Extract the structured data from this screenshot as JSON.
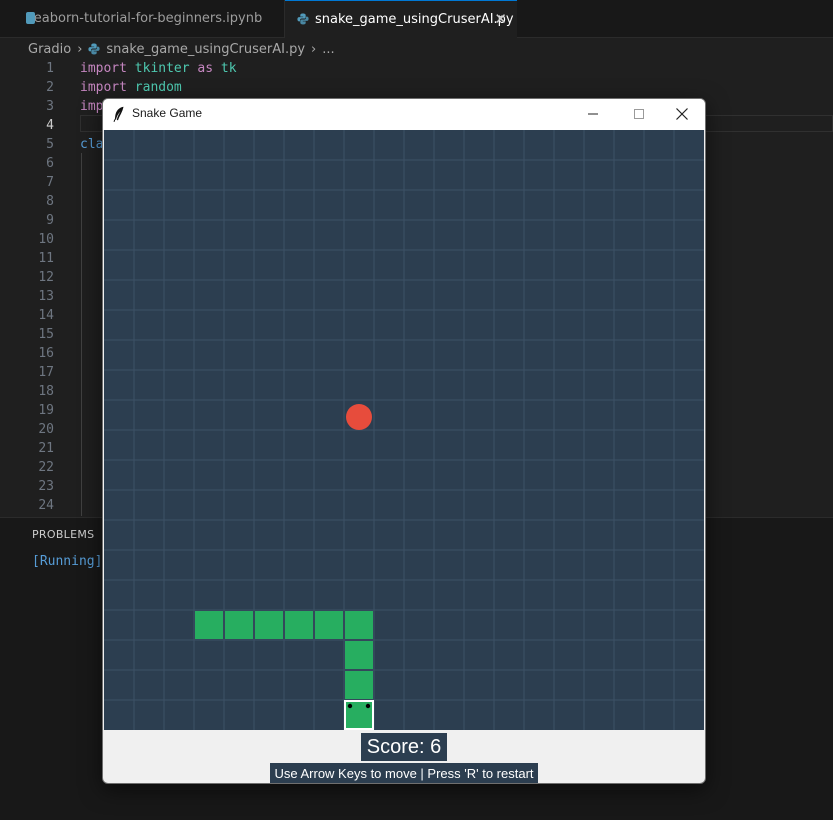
{
  "tabs": [
    {
      "label": "seaborn-tutorial-for-beginners.ipynb",
      "active": false,
      "icon": "notebook-icon"
    },
    {
      "label": "snake_game_usingCruserAI.py",
      "active": true,
      "icon": "python-icon"
    }
  ],
  "breadcrumb": {
    "folder": "Gradio",
    "file": "snake_game_usingCruserAI.py",
    "more": "..."
  },
  "editor": {
    "current_line": 4,
    "lines": [
      {
        "n": "1",
        "tokens": [
          [
            "kw",
            "import"
          ],
          [
            "",
            " "
          ],
          [
            "mod",
            "tkinter"
          ],
          [
            "",
            " "
          ],
          [
            "kw",
            "as"
          ],
          [
            "",
            " "
          ],
          [
            "mod",
            "tk"
          ]
        ]
      },
      {
        "n": "2",
        "tokens": [
          [
            "kw",
            "import"
          ],
          [
            "",
            " "
          ],
          [
            "mod",
            "random"
          ]
        ]
      },
      {
        "n": "3",
        "tokens": [
          [
            "kw",
            "imp"
          ]
        ]
      },
      {
        "n": "4",
        "tokens": []
      },
      {
        "n": "5",
        "tokens": [
          [
            "kwb",
            "cla"
          ]
        ]
      },
      {
        "n": "6",
        "tokens": []
      },
      {
        "n": "7",
        "tokens": []
      },
      {
        "n": "8",
        "tokens": []
      },
      {
        "n": "9",
        "tokens": []
      },
      {
        "n": "10",
        "tokens": []
      },
      {
        "n": "11",
        "tokens": []
      },
      {
        "n": "12",
        "tokens": []
      },
      {
        "n": "13",
        "tokens": []
      },
      {
        "n": "14",
        "tokens": []
      },
      {
        "n": "15",
        "tokens": []
      },
      {
        "n": "16",
        "tokens": []
      },
      {
        "n": "17",
        "tokens": []
      },
      {
        "n": "18",
        "tokens": []
      },
      {
        "n": "19",
        "tokens": []
      },
      {
        "n": "20",
        "tokens": []
      },
      {
        "n": "21",
        "tokens": []
      },
      {
        "n": "22",
        "tokens": []
      },
      {
        "n": "23",
        "tokens": []
      },
      {
        "n": "24",
        "tokens": []
      }
    ]
  },
  "panel": {
    "title": "PROBLEMS",
    "output": "[Running]"
  },
  "game_window": {
    "title": "Snake Game",
    "controls": {
      "minimize": "—",
      "maximize": "☐",
      "close": "✕"
    },
    "grid": {
      "cols": 20,
      "rows": 20
    },
    "food": {
      "col": 8,
      "row": 9
    },
    "snake": [
      [
        8,
        19
      ],
      [
        8,
        18
      ],
      [
        8,
        17
      ],
      [
        8,
        16
      ],
      [
        7,
        16
      ],
      [
        6,
        16
      ],
      [
        5,
        16
      ],
      [
        4,
        16
      ],
      [
        3,
        16
      ]
    ],
    "score_text": "Score: 6",
    "hint_text": "Use Arrow Keys to move | Press 'R' to restart"
  },
  "colors": {
    "board": "#2c3e50",
    "grid": "#3d5166",
    "snake": "#27ae60",
    "head_outline": "#ffffff",
    "food": "#e74c3c",
    "accent": "#0078d4"
  }
}
